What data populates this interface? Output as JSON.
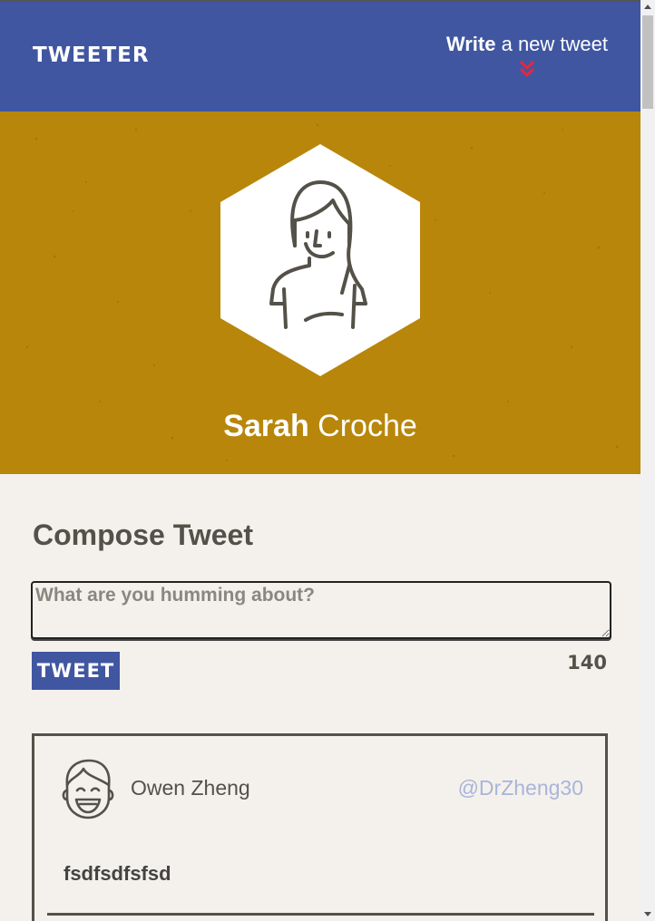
{
  "nav": {
    "brand": "TWEETER",
    "write_bold": "Write",
    "write_rest": " a new tweet",
    "chevron_icon": "double-chevron-down-icon",
    "chevron_color": "#e8263c"
  },
  "profile": {
    "avatar_icon": "woman-avatar-icon",
    "first_name": "Sarah",
    "last_name": " Croche"
  },
  "compose": {
    "title": "Compose Tweet",
    "placeholder": "What are you humming about?",
    "value": "",
    "button_label": "TWEET",
    "char_count": "140"
  },
  "tweets": [
    {
      "avatar_icon": "smiling-man-avatar-icon",
      "name": "Owen Zheng",
      "handle": "@DrZheng30",
      "content": "fsdfsdfsfsd"
    }
  ],
  "colors": {
    "nav_bg": "#4056a1",
    "header_bg": "#b8860b",
    "page_bg": "#f4f1ec",
    "text_dark": "#545149",
    "handle": "#a9b4da"
  }
}
